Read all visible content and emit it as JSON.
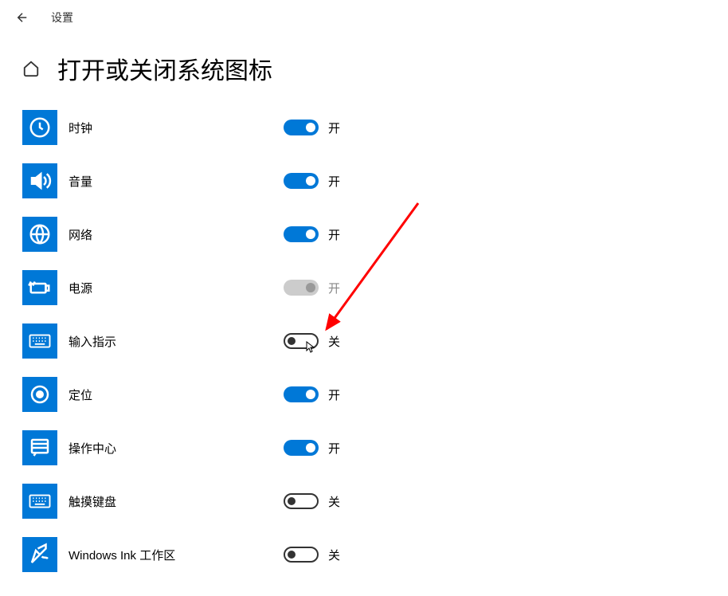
{
  "app": {
    "label": "设置"
  },
  "page": {
    "title": "打开或关闭系统图标"
  },
  "labels": {
    "on": "开",
    "off": "关"
  },
  "items": [
    {
      "icon": "clock-icon",
      "label": "时钟",
      "state": "on",
      "enabled": true
    },
    {
      "icon": "volume-icon",
      "label": "音量",
      "state": "on",
      "enabled": true
    },
    {
      "icon": "network-icon",
      "label": "网络",
      "state": "on",
      "enabled": true
    },
    {
      "icon": "power-icon",
      "label": "电源",
      "state": "on",
      "enabled": false
    },
    {
      "icon": "input-indicator-icon",
      "label": "输入指示",
      "state": "off",
      "enabled": true
    },
    {
      "icon": "location-icon",
      "label": "定位",
      "state": "on",
      "enabled": true
    },
    {
      "icon": "action-center-icon",
      "label": "操作中心",
      "state": "on",
      "enabled": true
    },
    {
      "icon": "touch-keyboard-icon",
      "label": "触摸键盘",
      "state": "off",
      "enabled": true
    },
    {
      "icon": "windows-ink-icon",
      "label": "Windows Ink 工作区",
      "state": "off",
      "enabled": true
    }
  ]
}
